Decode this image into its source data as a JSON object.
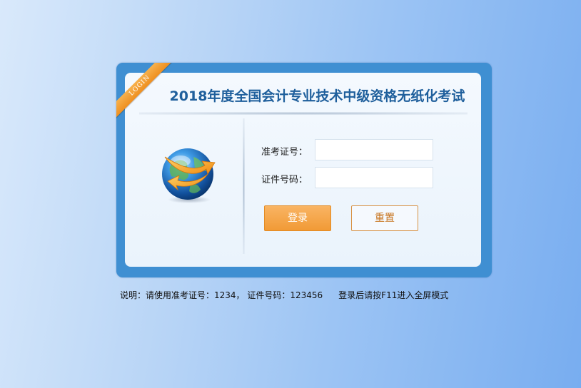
{
  "ribbon": {
    "text": "LOGIN"
  },
  "header": {
    "title": "2018年度全国会计专业技术中级资格无纸化考试"
  },
  "form": {
    "exam_id_label": "准考证号：",
    "exam_id_value": "",
    "id_number_label": "证件号码：",
    "id_number_value": "",
    "login_label": "登录",
    "reset_label": "重置"
  },
  "note": {
    "instructions": "说明：请使用准考证号：1234， 证件号码：123456",
    "fullscreen_tip": "登录后请按F11进入全屏模式"
  },
  "icons": {
    "globe": "globe-arrow-icon"
  },
  "colors": {
    "frame": "#3f8fd2",
    "title": "#1f5f9c",
    "login_button": "#f19a36",
    "reset_border": "#d89245"
  }
}
